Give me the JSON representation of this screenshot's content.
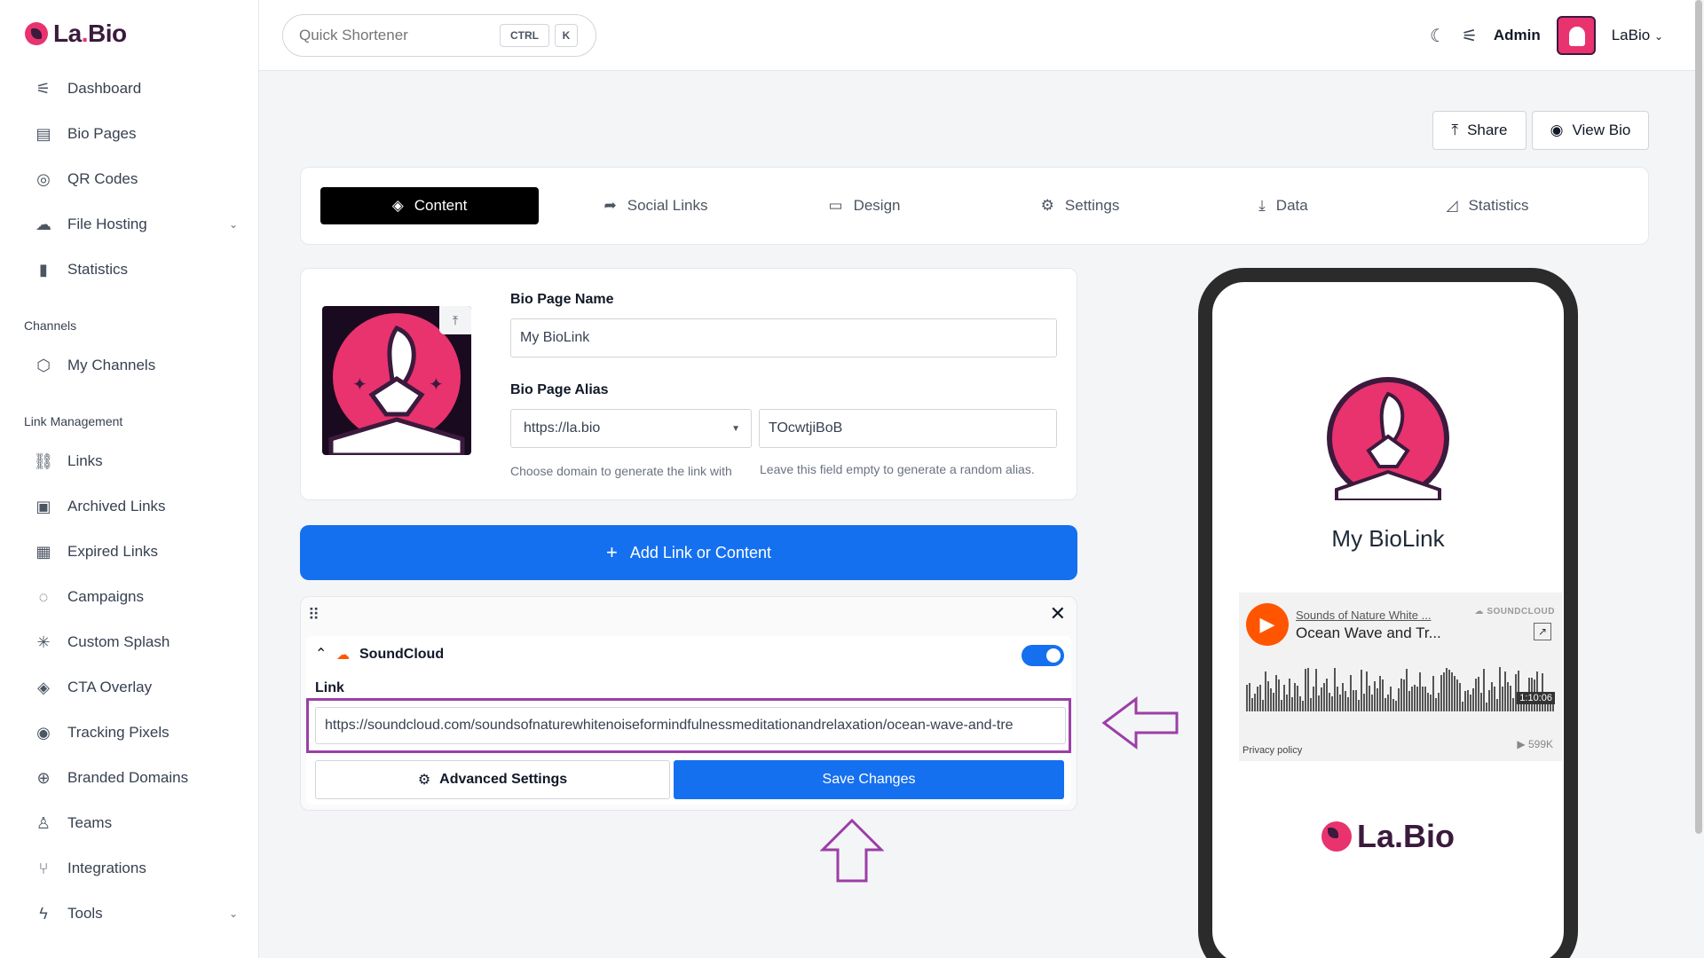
{
  "brand": {
    "name_main": "La",
    "name_dot": ".",
    "name_tail": "Bio"
  },
  "sidebar": {
    "items": [
      {
        "label": "Dashboard",
        "icon": "sliders-icon",
        "glyph": "⚟"
      },
      {
        "label": "Bio Pages",
        "icon": "layout-icon",
        "glyph": "▤"
      },
      {
        "label": "QR Codes",
        "icon": "aperture-icon",
        "glyph": "◎"
      },
      {
        "label": "File Hosting",
        "icon": "upload-cloud-icon",
        "glyph": "☁"
      },
      {
        "label": "Statistics",
        "icon": "bar-chart-icon",
        "glyph": "▮"
      }
    ],
    "channels_heading": "Channels",
    "channels": [
      {
        "label": "My Channels",
        "icon": "box-icon",
        "glyph": "⬡"
      }
    ],
    "link_heading": "Link Management",
    "links": [
      {
        "label": "Links",
        "icon": "link-icon",
        "glyph": "⛓"
      },
      {
        "label": "Archived Links",
        "icon": "archive-icon",
        "glyph": "▣"
      },
      {
        "label": "Expired Links",
        "icon": "calendar-icon",
        "glyph": "▦"
      },
      {
        "label": "Campaigns",
        "icon": "target-icon",
        "glyph": "◌"
      },
      {
        "label": "Custom Splash",
        "icon": "loader-icon",
        "glyph": "✳"
      },
      {
        "label": "CTA Overlay",
        "icon": "layers-icon",
        "glyph": "◈"
      },
      {
        "label": "Tracking Pixels",
        "icon": "compass-icon",
        "glyph": "◉"
      },
      {
        "label": "Branded Domains",
        "icon": "globe-icon",
        "glyph": "⊕"
      },
      {
        "label": "Teams",
        "icon": "users-icon",
        "glyph": "♙"
      },
      {
        "label": "Integrations",
        "icon": "git-branch-icon",
        "glyph": "⑂"
      },
      {
        "label": "Tools",
        "icon": "zap-icon",
        "glyph": "ϟ"
      }
    ]
  },
  "topbar": {
    "search_placeholder": "Quick Shortener",
    "kbd_ctrl": "CTRL",
    "kbd_k": "K",
    "admin_label": "Admin",
    "user_name": "LaBio"
  },
  "actions": {
    "share": "Share",
    "view_bio": "View Bio"
  },
  "tabs": [
    {
      "label": "Content",
      "icon": "layers-icon",
      "glyph": "◈"
    },
    {
      "label": "Social Links",
      "icon": "share-arrow-icon",
      "glyph": "➦"
    },
    {
      "label": "Design",
      "icon": "monitor-icon",
      "glyph": "▭"
    },
    {
      "label": "Settings",
      "icon": "gears-icon",
      "glyph": "⚙"
    },
    {
      "label": "Data",
      "icon": "download-icon",
      "glyph": "⤓"
    },
    {
      "label": "Statistics",
      "icon": "area-chart-icon",
      "glyph": "◿"
    }
  ],
  "bio": {
    "name_label": "Bio Page Name",
    "name_value": "My BioLink",
    "alias_label": "Bio Page Alias",
    "domain_value": "https://la.bio",
    "alias_value": "TOcwtjiBoB",
    "domain_hint": "Choose domain to generate the link with",
    "alias_hint": "Leave this field empty to generate a random alias."
  },
  "add_button": "Add Link or Content",
  "block": {
    "title": "SoundCloud",
    "link_label": "Link",
    "link_value": "https://soundcloud.com/soundsofnaturewhitenoiseformindfulnessmeditationandrelaxation/ocean-wave-and-tre",
    "advanced": "Advanced Settings",
    "save": "Save Changes",
    "enabled": true
  },
  "preview": {
    "name": "My BioLink",
    "sc_artist": "Sounds of Nature White ...",
    "sc_track": "Ocean Wave and Tr...",
    "sc_brand": "SOUNDCLOUD",
    "sc_duration": "1:10:06",
    "sc_privacy": "Privacy policy",
    "sc_plays": "599K",
    "footer_brand": "La.Bio"
  },
  "colors": {
    "accent": "#1570ef",
    "brand_pink": "#e8336e",
    "brand_dark": "#3b1a3d",
    "highlight": "#9b3fa6",
    "soundcloud": "#ff5500"
  }
}
